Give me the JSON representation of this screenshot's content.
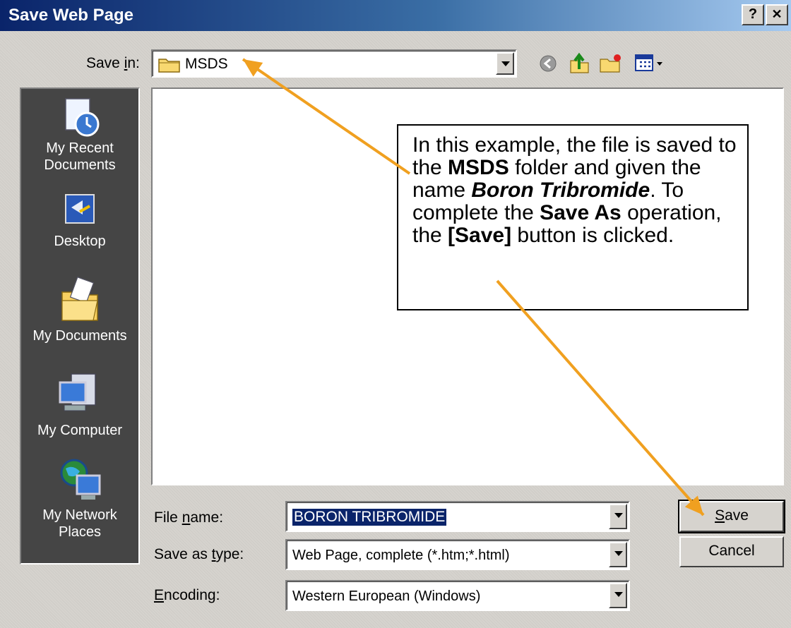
{
  "window": {
    "title": "Save Web Page",
    "help_label": "?",
    "close_label": "✕"
  },
  "save_in": {
    "label_pre": "Save ",
    "label_u": "i",
    "label_post": "n:",
    "value": "MSDS"
  },
  "places": [
    {
      "label_line1": "My Recent",
      "label_line2": "Documents",
      "icon": "recent-documents-icon"
    },
    {
      "label_line1": "Desktop",
      "label_line2": "",
      "icon": "desktop-icon"
    },
    {
      "label_line1": "My Documents",
      "label_line2": "",
      "icon": "my-documents-icon"
    },
    {
      "label_line1": "My Computer",
      "label_line2": "",
      "icon": "my-computer-icon"
    },
    {
      "label_line1": "My Network",
      "label_line2": "Places",
      "icon": "network-places-icon"
    }
  ],
  "callout": {
    "t1": "In this example, the file is saved to the ",
    "b1": "MSDS",
    "t2": " folder and given the name ",
    "bi1": "Boron Tribromide",
    "t3": ". To complete the ",
    "b2": "Save As",
    "t4": " operation, the ",
    "b3": "[Save]",
    "t5": " button is clicked."
  },
  "file_name": {
    "label_pre": "File ",
    "label_u": "n",
    "label_post": "ame:",
    "value": "BORON TRIBROMIDE"
  },
  "save_as_type": {
    "label_pre": "Save as ",
    "label_u": "t",
    "label_post": "ype:",
    "value": "Web Page, complete (*.htm;*.html)"
  },
  "encoding": {
    "label_pre": "",
    "label_u": "E",
    "label_post": "ncoding:",
    "value": "Western European (Windows)"
  },
  "buttons": {
    "save_u": "S",
    "save_rest": "ave",
    "cancel": "Cancel"
  },
  "colors": {
    "arrow": "#f0a020",
    "title_start": "#0a246a",
    "selection": "#0a246a"
  }
}
